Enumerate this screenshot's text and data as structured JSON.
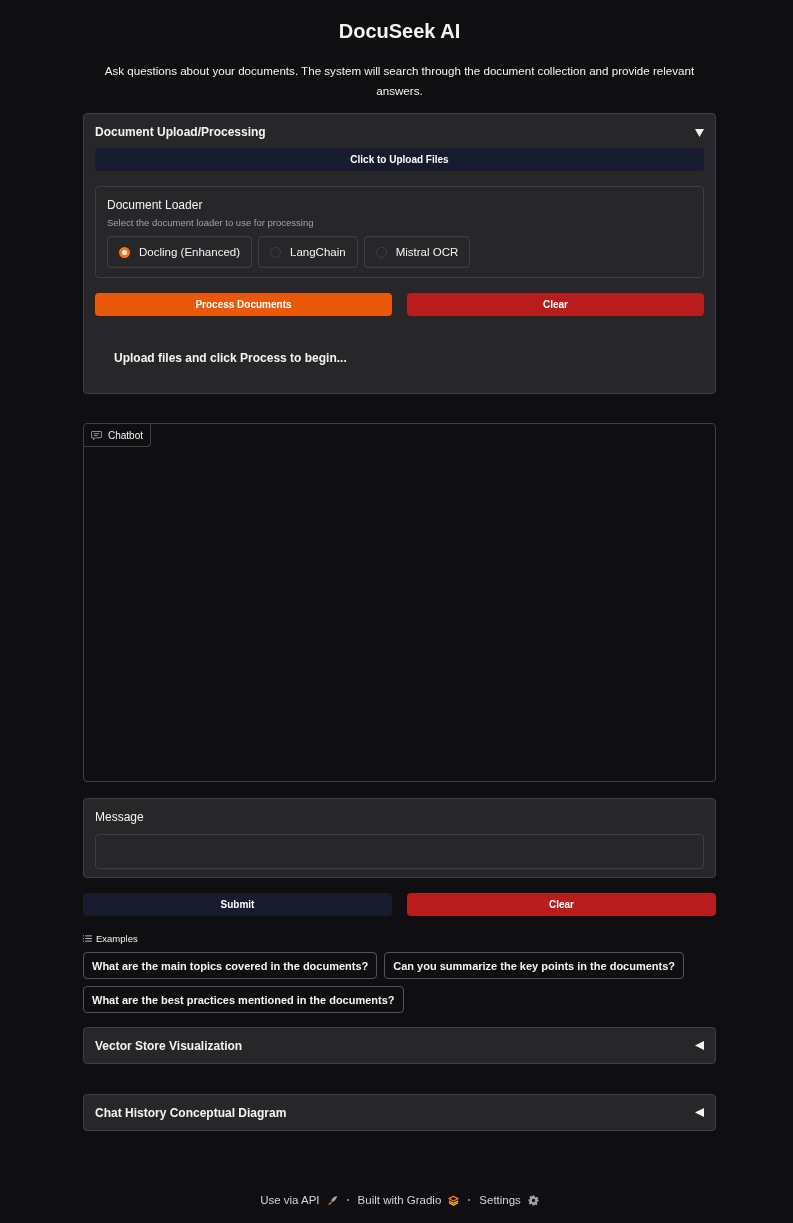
{
  "header": {
    "title": "DocuSeek AI",
    "description": "Ask questions about your documents. The system will search through the document collection and provide relevant answers."
  },
  "upload_panel": {
    "title": "Document Upload/Processing",
    "expanded": true,
    "upload_button": "Click to Upload Files",
    "loader": {
      "label": "Document Loader",
      "info": "Select the document loader to use for processing",
      "options": [
        {
          "label": "Docling (Enhanced)",
          "selected": true
        },
        {
          "label": "LangChain",
          "selected": false
        },
        {
          "label": "Mistral OCR",
          "selected": false
        }
      ]
    },
    "buttons": [
      {
        "label": "Process Documents",
        "kind": "primary"
      },
      {
        "label": "Clear",
        "kind": "stop"
      }
    ],
    "status": "Upload files and click Process to begin..."
  },
  "chatbot": {
    "label": "Chatbot"
  },
  "message": {
    "label": "Message"
  },
  "chat_buttons": [
    {
      "label": "Submit",
      "kind": "secondary"
    },
    {
      "label": "Clear",
      "kind": "stop"
    }
  ],
  "examples": {
    "label": "Examples",
    "items": [
      "What are the main topics covered in the documents?",
      "Can you summarize the key points in the documents?",
      "What are the best practices mentioned in the documents?"
    ]
  },
  "accordions": [
    {
      "title": "Vector Store Visualization",
      "expanded": false
    },
    {
      "title": "Chat History Conceptual Diagram",
      "expanded": false
    }
  ],
  "footer": [
    {
      "label": "Use via API",
      "kind": "api"
    },
    {
      "label": "Built with Gradio",
      "kind": "gradio"
    },
    {
      "label": "Settings",
      "kind": "settings"
    }
  ]
}
